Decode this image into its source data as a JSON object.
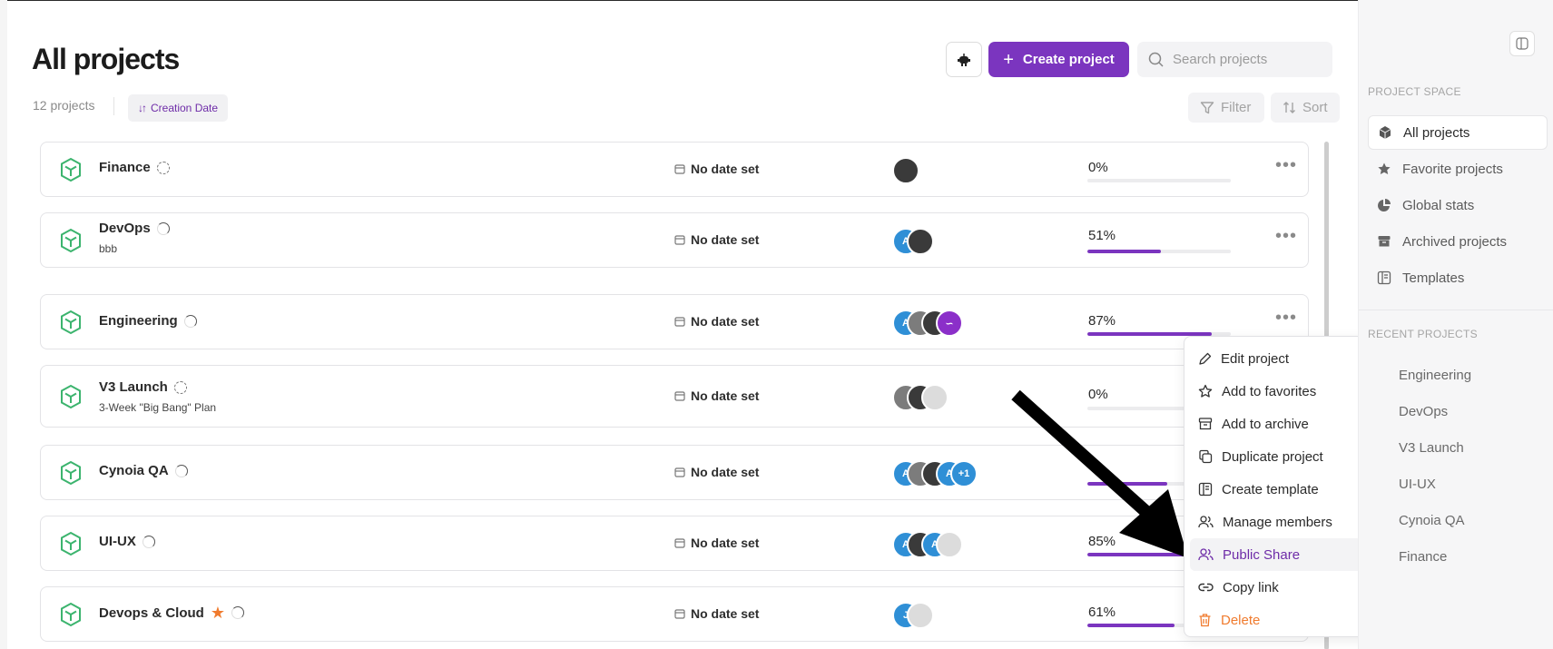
{
  "header": {
    "title": "All projects",
    "count": "12 projects",
    "sort_chip": "Creation Date",
    "create_label": "Create project",
    "search_placeholder": "Search projects",
    "filter_label": "Filter",
    "sort_label": "Sort"
  },
  "projects": [
    {
      "name": "Finance",
      "sub": "",
      "date": "No date set",
      "progress": "0%",
      "progress_value": 0,
      "favorite": false
    },
    {
      "name": "DevOps",
      "sub": "bbb",
      "date": "No date set",
      "progress": "51%",
      "progress_value": 51,
      "favorite": false
    },
    {
      "name": "Engineering",
      "sub": "",
      "date": "No date set",
      "progress": "87%",
      "progress_value": 87,
      "favorite": false
    },
    {
      "name": "V3 Launch",
      "sub": "3-Week \"Big Bang\" Plan",
      "date": "No date set",
      "progress": "0%",
      "progress_value": 0,
      "favorite": false
    },
    {
      "name": "Cynoia QA",
      "sub": "",
      "date": "No date set",
      "progress": "",
      "progress_value": 56,
      "favorite": false,
      "more_members": "+1"
    },
    {
      "name": "UI-UX",
      "sub": "",
      "date": "No date set",
      "progress": "85%",
      "progress_value": 85,
      "favorite": false
    },
    {
      "name": "Devops & Cloud",
      "sub": "",
      "date": "No date set",
      "progress": "61%",
      "progress_value": 61,
      "favorite": true
    }
  ],
  "context_menu": {
    "items": [
      {
        "label": "Edit project",
        "icon": "pencil-icon"
      },
      {
        "label": "Add to favorites",
        "icon": "star-outline-icon"
      },
      {
        "label": "Add to archive",
        "icon": "archive-icon"
      },
      {
        "label": "Duplicate project",
        "icon": "copy-icon"
      },
      {
        "label": "Create template",
        "icon": "template-icon"
      },
      {
        "label": "Manage members",
        "icon": "users-icon"
      },
      {
        "label": "Public Share",
        "icon": "share-users-icon",
        "active": true
      },
      {
        "label": "Copy link",
        "icon": "link-icon"
      },
      {
        "label": "Delete",
        "icon": "trash-icon",
        "danger": true
      }
    ]
  },
  "sidebar": {
    "section_space": "PROJECT SPACE",
    "nav": [
      {
        "label": "All projects",
        "icon": "cube-icon",
        "active": true
      },
      {
        "label": "Favorite projects",
        "icon": "star-icon"
      },
      {
        "label": "Global stats",
        "icon": "pie-chart-icon"
      },
      {
        "label": "Archived projects",
        "icon": "archive-icon"
      },
      {
        "label": "Templates",
        "icon": "template-icon"
      }
    ],
    "section_recent": "RECENT PROJECTS",
    "recent": [
      "Engineering",
      "DevOps",
      "V3 Launch",
      "UI-UX",
      "Cynoia QA",
      "Finance"
    ]
  },
  "colors": {
    "accent": "#7b35bf",
    "project_icon": "#3cb46e",
    "danger": "#f07b2e"
  }
}
